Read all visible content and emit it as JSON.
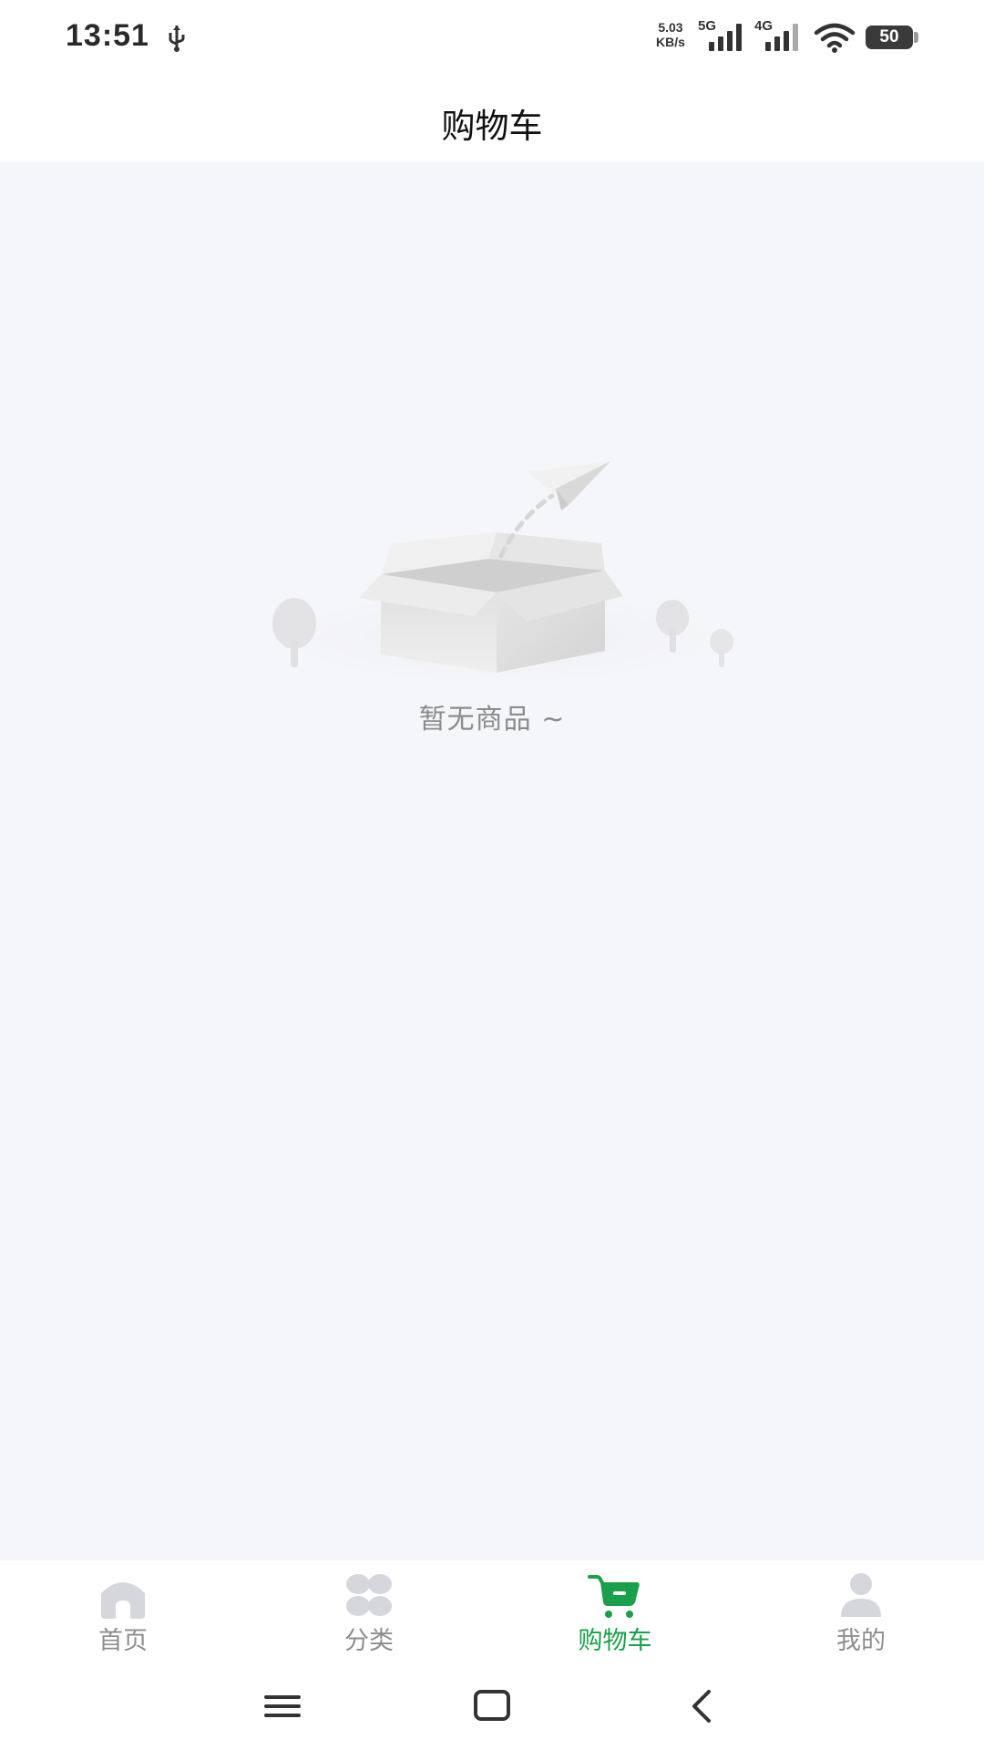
{
  "status_bar": {
    "time": "13:51",
    "net_speed_value": "5.03",
    "net_speed_unit": "KB/s",
    "sim1_type": "5G",
    "sim2_type": "4G",
    "battery_level": "50"
  },
  "header": {
    "title": "购物车"
  },
  "empty_state": {
    "message": "暂无商品 ~",
    "illustration": "empty-box-illustration"
  },
  "tabs": [
    {
      "label": "首页",
      "icon": "home-icon",
      "active": false
    },
    {
      "label": "分类",
      "icon": "category-icon",
      "active": false
    },
    {
      "label": "购物车",
      "icon": "cart-icon",
      "active": true
    },
    {
      "label": "我的",
      "icon": "profile-icon",
      "active": false
    }
  ],
  "colors": {
    "accent": "#1aa04a",
    "inactive": "#8d8d8d",
    "background": "#f5f6f9"
  },
  "system_nav": [
    "menu-icon",
    "home-square-icon",
    "back-icon"
  ]
}
